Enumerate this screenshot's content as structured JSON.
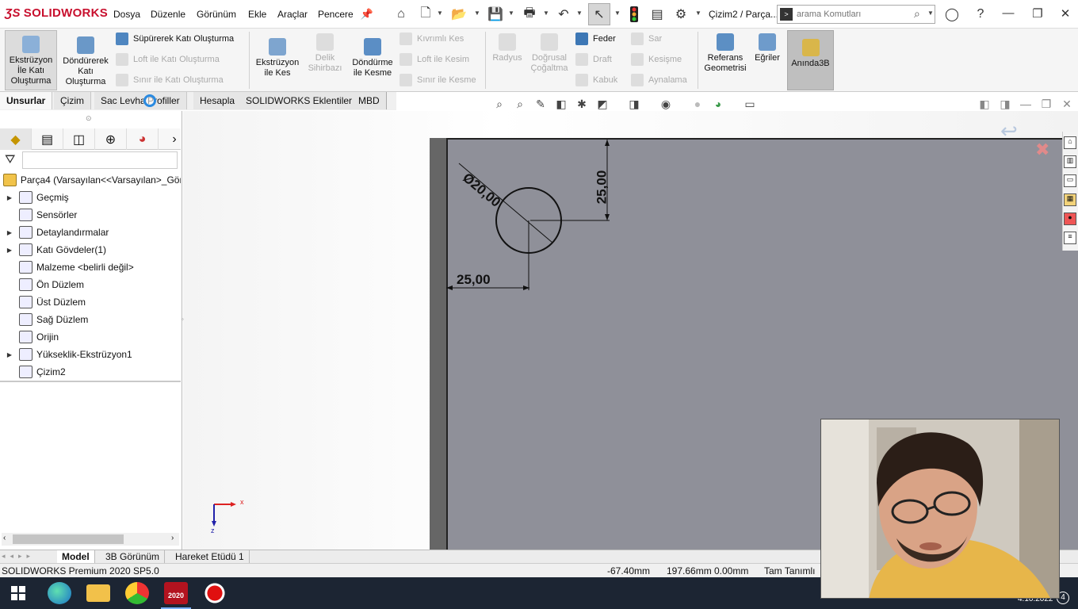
{
  "app": {
    "logo_text": "SOLIDWORKS",
    "brand_color": "#c8102e"
  },
  "menu": [
    "Dosya",
    "Düzenle",
    "Görünüm",
    "Ekle",
    "Araçlar",
    "Pencere"
  ],
  "document_title": "Çizim2 / Parça...",
  "search": {
    "placeholder": "arama Komutları"
  },
  "ribbon": {
    "extrude_boss": "Ekstrüzyon İle Katı Oluşturma",
    "revolve_boss": "Döndürerek Katı Oluşturma",
    "sweep_boss": "Süpürerek Katı Oluşturma",
    "loft_boss": "Loft ile Katı Oluşturma",
    "boundary_boss": "Sınır ile Katı Oluşturma",
    "extrude_cut": "Ekstrüzyon ile Kes",
    "hole_wizard": "Delik Sihirbazı",
    "revolve_cut": "Döndürme ile Kesme",
    "swept_cut": "Kıvrımlı Kes",
    "loft_cut": "Loft ile Kesim",
    "boundary_cut": "Sınır ile Kesme",
    "fillet": "Radyus",
    "linear_pattern": "Doğrusal Çoğaltma",
    "rib": "Feder",
    "draft": "Draft",
    "shell": "Kabuk",
    "wrap": "Sar",
    "intersect": "Kesişme",
    "mirror": "Aynalama",
    "ref_geometry": "Referans Geometrisi",
    "curves": "Eğriler",
    "instant3d": "Anında3B"
  },
  "command_tabs": [
    "Unsurlar",
    "Çizim",
    "Sac Levha",
    "Profiller",
    "Hesapla",
    "SOLIDWORKS Eklentileri",
    "MBD"
  ],
  "tree": {
    "root": "Parça4  (Varsayılan<<Varsayılan>_Gör",
    "items": [
      {
        "label": "Geçmiş",
        "expand": true
      },
      {
        "label": "Sensörler",
        "expand": false
      },
      {
        "label": "Detaylandırmalar",
        "expand": true
      },
      {
        "label": "Katı Gövdeler(1)",
        "expand": true
      },
      {
        "label": "Malzeme <belirli değil>",
        "expand": false
      },
      {
        "label": "Ön Düzlem",
        "expand": false
      },
      {
        "label": "Üst Düzlem",
        "expand": false
      },
      {
        "label": "Sağ Düzlem",
        "expand": false
      },
      {
        "label": "Orijin",
        "expand": false
      },
      {
        "label": "Yükseklik-Ekstrüzyon1",
        "expand": true
      },
      {
        "label": "Çizim2",
        "expand": false
      }
    ]
  },
  "sketch": {
    "diameter": "Ø20,00",
    "vertical_dim": "25,00",
    "horizontal_dim": "25,00"
  },
  "axis_labels": {
    "x": "x",
    "z": "z"
  },
  "bottom_tabs": [
    "Model",
    "3B Görünüm",
    "Hareket Etüdü 1"
  ],
  "status": {
    "product": "SOLIDWORKS Premium 2020 SP5.0",
    "x": "-67.40mm",
    "y": "197.66mm",
    "z": "0.00mm",
    "state": "Tam Tanımlı"
  },
  "taskbar": {
    "date": "4.10.2022",
    "badge": "4",
    "sw_label": "2020"
  }
}
